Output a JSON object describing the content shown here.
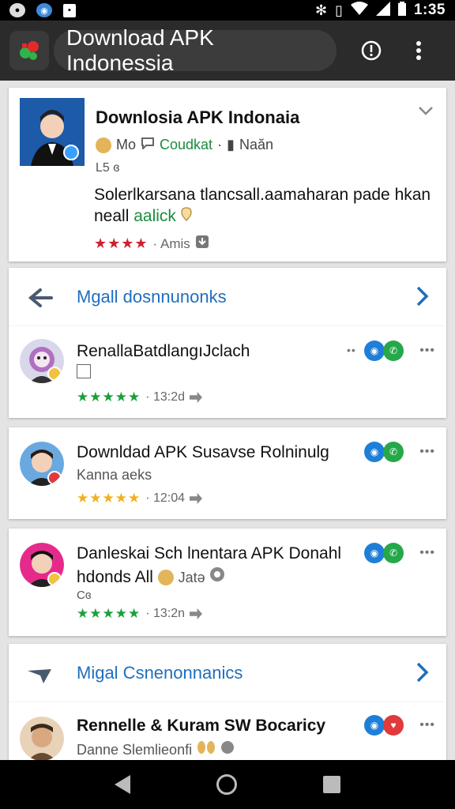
{
  "status_bar": {
    "time": "1:35"
  },
  "toolbar": {
    "title": "Download APK Indonessia"
  },
  "featured": {
    "title": "Downlosia APK Indonaia",
    "meta_author": "Mo",
    "meta_contact": "Coudkat",
    "meta_extra": "Naăn",
    "small_line": "L5 ɞ",
    "desc_main": "Solerlkarsana tlancsall.aamaharan pade hkan neall",
    "desc_link": "aalick",
    "rating_stars": "★★★★",
    "rating_text": "· Amis"
  },
  "sections": [
    {
      "label": "Mgall dosnnunonks"
    },
    {
      "label": "Migal Csnenonnanics"
    }
  ],
  "items": [
    {
      "title": "RenallaBatdlangıJclach",
      "sub": "",
      "stars": "★★★★★",
      "meta": "· 13:2d"
    },
    {
      "title": "Downldad APK Susavse Rolninulg",
      "sub": "Kanna aeks",
      "stars": "★★★★★",
      "meta": "· 12:04"
    },
    {
      "title": "Danleskai Sch lnentara APK Donahl",
      "sub": "hdonds All",
      "sub2": "Jatə",
      "sub3": "Cɞ",
      "stars": "★★★★★",
      "meta": "· 13:2n"
    },
    {
      "title": "Rennelle & Kuram SW Bocaricy",
      "sub": "Danne Slemlieonfi"
    }
  ],
  "colors": {
    "accent_blue": "#1f6fbf",
    "green": "#1b8b3e",
    "star_red": "#d0202f",
    "star_yellow": "#f2b01e"
  }
}
